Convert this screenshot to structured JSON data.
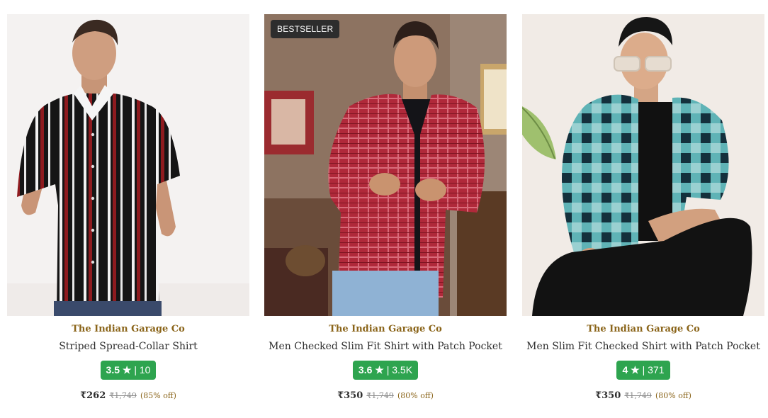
{
  "products": [
    {
      "brand": "The Indian Garage Co",
      "title": "Striped Spread-Collar Shirt",
      "rating": "3.5",
      "star": "★",
      "rating_count": "| 10",
      "price": "₹262",
      "mrp": "₹1,749",
      "discount": "(85% off)",
      "badge": ""
    },
    {
      "brand": "The Indian Garage Co",
      "title": "Men Checked Slim Fit Shirt with Patch Pocket",
      "rating": "3.6",
      "star": "★",
      "rating_count": "| 3.5K",
      "price": "₹350",
      "mrp": "₹1,749",
      "discount": "(80% off)",
      "badge": "BESTSELLER"
    },
    {
      "brand": "The Indian Garage Co",
      "title": "Men Slim Fit Checked Shirt with Patch Pocket",
      "rating": "4",
      "star": "★",
      "rating_count": "| 371",
      "price": "₹350",
      "mrp": "₹1,749",
      "discount": "(80% off)",
      "badge": ""
    }
  ],
  "colors": {
    "brand_text": "#8a6419",
    "rating_green": "#2ea44f",
    "badge_bg": "#2d2d2d"
  }
}
